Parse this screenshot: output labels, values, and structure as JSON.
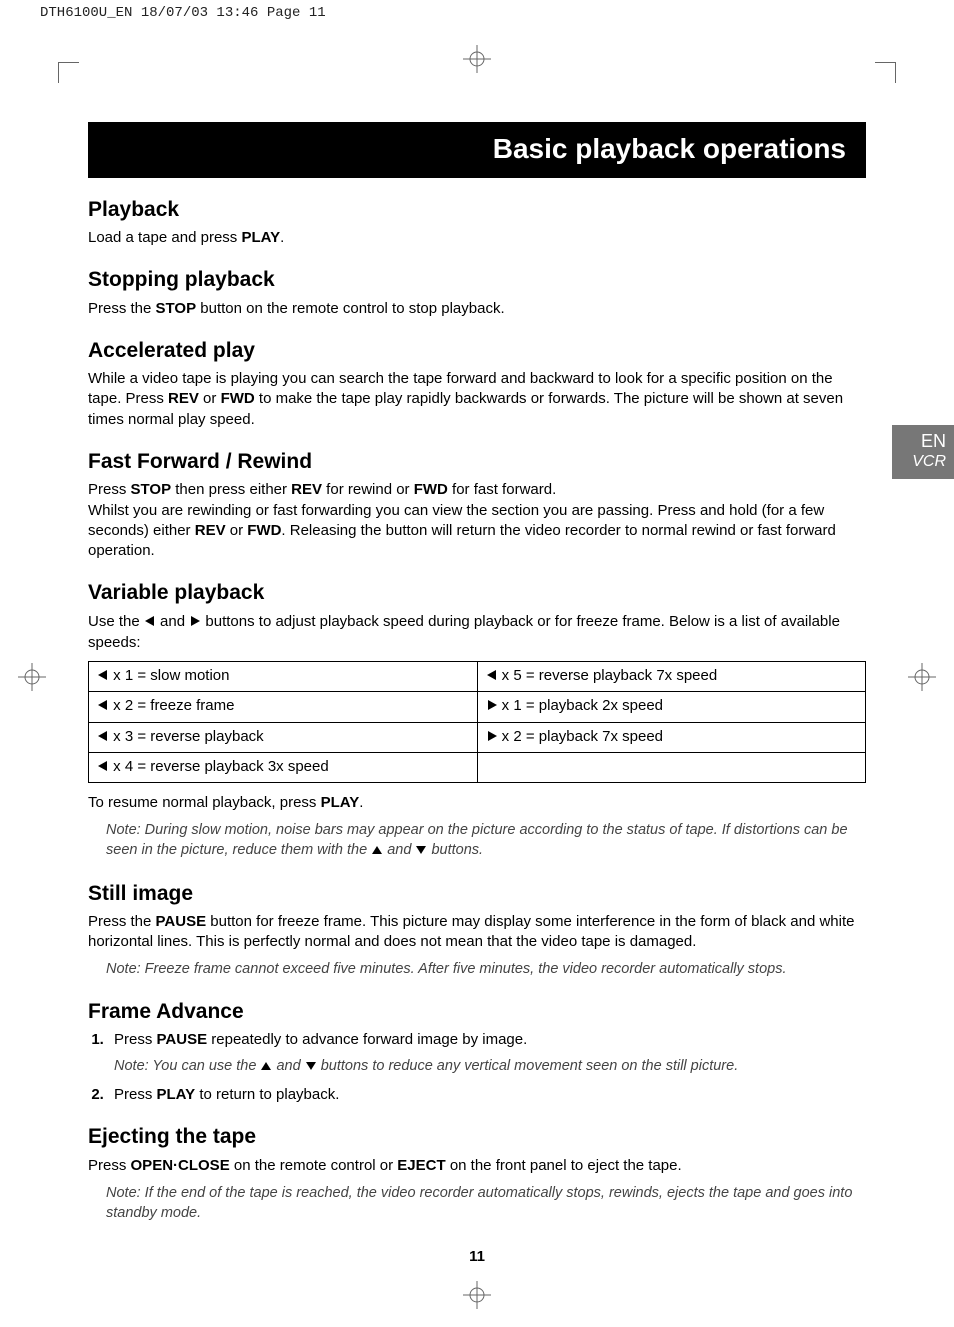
{
  "header_strip": "DTH6100U_EN  18/07/03  13:46  Page 11",
  "title": "Basic playback operations",
  "side_tab": {
    "lang": "EN",
    "mode": "VCR"
  },
  "page_number": "11",
  "sections": {
    "playback": {
      "heading": "Playback",
      "body_pre": "Load a tape and press ",
      "button": "PLAY",
      "body_post": "."
    },
    "stopping": {
      "heading": "Stopping playback",
      "pre": "Press the ",
      "btn": "STOP",
      "post": " button on the remote control to stop playback."
    },
    "accel": {
      "heading": "Accelerated play",
      "p1a": "While a video tape is playing you can search the tape forward and backward to look for a specific position on the tape. Press ",
      "rev": "REV",
      "mid": " or ",
      "fwd": "FWD",
      "p1b": " to make the tape play rapidly backwards or forwards. The picture will be shown at seven times normal play speed."
    },
    "ffrw": {
      "heading": "Fast Forward / Rewind",
      "p1a": "Press ",
      "stop": "STOP",
      "p1b": " then press either ",
      "rev": "REV",
      "p1c": " for rewind or ",
      "fwd": "FWD",
      "p1d": " for fast forward.",
      "p2a": "Whilst you are rewinding or fast forwarding you can view the section you are passing. Press and hold (for a few seconds) either ",
      "rev2": "REV",
      "p2b": " or ",
      "fwd2": "FWD",
      "p2c": ". Releasing the button will return the video recorder to normal rewind or fast forward operation."
    },
    "variable": {
      "heading": "Variable playback",
      "intro_a": "Use the ",
      "intro_b": " and ",
      "intro_c": " buttons to adjust playback speed during playback or for freeze frame. Below is a list of available speeds:",
      "resume_a": "To resume normal playback, press ",
      "resume_btn": "PLAY",
      "resume_b": ".",
      "note_a": "Note: During slow motion, noise bars may appear on the picture according to the status of tape. If distortions can be seen in the picture, reduce them with the ",
      "note_b": " and ",
      "note_c": " buttons."
    },
    "still": {
      "heading": "Still image",
      "p_a": "Press the ",
      "btn": "PAUSE",
      "p_b": " button for freeze frame. This picture may display some interference in the form of black and white horizontal lines. This is perfectly normal and does not mean that the video tape is damaged.",
      "note": "Note: Freeze frame cannot exceed five minutes. After five minutes, the video recorder automatically stops."
    },
    "frame": {
      "heading": "Frame Advance",
      "step1_a": "Press ",
      "step1_btn": "PAUSE",
      "step1_b": " repeatedly to advance forward image by image.",
      "note_a": "Note: You can use the ",
      "note_b": " and ",
      "note_c": " buttons to reduce any vertical movement seen on the still picture.",
      "step2_a": "Press ",
      "step2_btn": "PLAY",
      "step2_b": " to return to playback."
    },
    "eject": {
      "heading": "Ejecting the tape",
      "p_a": "Press ",
      "btn1": "OPEN·CLOSE",
      "p_b": " on the remote control or ",
      "btn2": "EJECT",
      "p_c": " on the front panel to eject the tape.",
      "note": "Note: If the end of the tape is reached, the video recorder automatically stops, rewinds, ejects the tape and goes into standby mode."
    }
  },
  "speed_table": {
    "rows": [
      {
        "left_dir": "left",
        "left_text": " x 1 = slow motion",
        "right_dir": "left",
        "right_text": " x 5 = reverse playback 7x speed"
      },
      {
        "left_dir": "left",
        "left_text": " x 2 = freeze frame",
        "right_dir": "right",
        "right_text": " x 1 = playback 2x speed"
      },
      {
        "left_dir": "left",
        "left_text": " x 3 = reverse playback",
        "right_dir": "right",
        "right_text": " x 2 = playback 7x speed"
      },
      {
        "left_dir": "left",
        "left_text": " x 4 = reverse playback 3x speed",
        "right_dir": "",
        "right_text": ""
      }
    ]
  }
}
